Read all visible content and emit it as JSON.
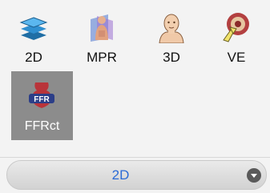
{
  "tools": [
    {
      "id": "2d",
      "label": "2D",
      "icon": "layers-icon"
    },
    {
      "id": "mpr",
      "label": "MPR",
      "icon": "mpr-body-icon"
    },
    {
      "id": "3d",
      "label": "3D",
      "icon": "head-3d-icon"
    },
    {
      "id": "ve",
      "label": "VE",
      "icon": "virtual-endoscopy-icon"
    },
    {
      "id": "ffrct",
      "label": "FFRct",
      "icon": "ffr-heart-icon",
      "active": true
    }
  ],
  "selector": {
    "value": "2D",
    "icon": "chevron-down-icon"
  },
  "colors": {
    "active_bg": "#8c8c8c",
    "selector_text": "#2b6bd6"
  }
}
